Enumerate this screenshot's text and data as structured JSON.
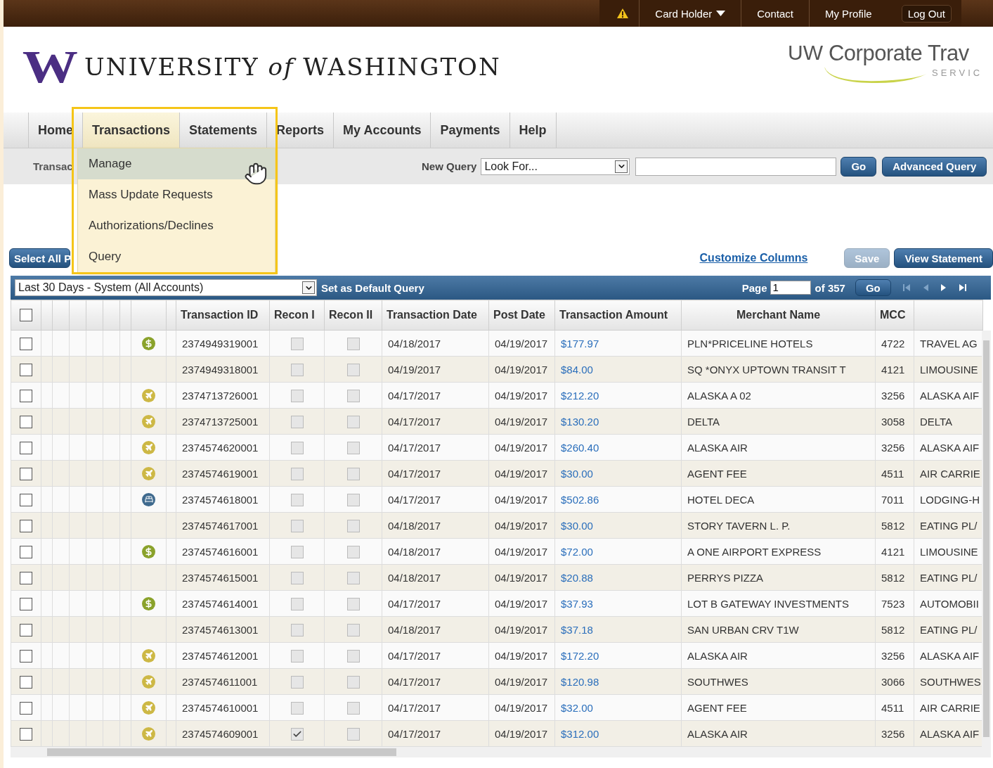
{
  "top_bar": {
    "items": [
      {
        "kind": "warning"
      },
      {
        "kind": "menu",
        "label": "Card Holder"
      },
      {
        "kind": "link",
        "label": "Contact"
      },
      {
        "kind": "link",
        "label": "My Profile"
      },
      {
        "kind": "button",
        "label": "Log Out"
      }
    ]
  },
  "header": {
    "logo_letter": "W",
    "university": "UNIVERSITY *of* WASHINGTON",
    "brand_prefix": "UW",
    "brand_name": "Corporate Trav",
    "brand_sub": "SERVIC"
  },
  "nav": {
    "tabs": [
      {
        "label": "Home",
        "selected": false
      },
      {
        "label": "Transactions",
        "selected": true
      },
      {
        "label": "Statements",
        "selected": false
      },
      {
        "label": "Reports",
        "selected": false
      },
      {
        "label": "My Accounts",
        "selected": false
      },
      {
        "label": "Payments",
        "selected": false
      },
      {
        "label": "Help",
        "selected": false
      }
    ],
    "menu": [
      {
        "label": "Manage",
        "selected": true
      },
      {
        "label": "Mass Update Requests",
        "selected": false
      },
      {
        "label": "Authorizations/Declines",
        "selected": false
      },
      {
        "label": "Query",
        "selected": false
      }
    ]
  },
  "sub_bar": {
    "title": "Transac",
    "new_query_label": "New Query",
    "select_value": "Look For...",
    "go": "Go",
    "advanced": "Advanced Query"
  },
  "toolbar": {
    "select_all": "Select All P",
    "customize": "Customize Columns",
    "save": "Save",
    "save_disabled": true,
    "view_statement": "View Statement"
  },
  "query_bar": {
    "query": "Last 30 Days - System (All Accounts)",
    "set_default": "Set as Default Query",
    "page_label": "Page",
    "page_value": "1",
    "of_pages": "of 357",
    "go": "Go"
  },
  "table": {
    "select_all_checked": false,
    "columns": [
      "Transaction ID",
      "Recon I",
      "Recon II",
      "Transaction Date",
      "Post Date",
      "Transaction Amount",
      "Merchant Name",
      "MCC"
    ],
    "rows": [
      {
        "checked": false,
        "kind": "dollar",
        "id": "2374949319001",
        "recon_1": false,
        "recon_2": false,
        "transaction_date": "04/18/2017",
        "post_date": "04/19/2017",
        "amount": "$177.97",
        "merchant": "PLN*PRICELINE HOTELS",
        "mcc": "4722",
        "column_12": "TRAVEL AG"
      },
      {
        "checked": false,
        "kind": "plain",
        "id": "2374949318001",
        "recon_1": false,
        "recon_2": false,
        "transaction_date": "04/19/2017",
        "post_date": "04/19/2017",
        "amount": "$84.00",
        "merchant": "SQ *ONYX UPTOWN TRANSIT T",
        "mcc": "4121",
        "column_12": "LIMOUSINE"
      },
      {
        "checked": false,
        "kind": "plane",
        "id": "2374713726001",
        "recon_1": false,
        "recon_2": false,
        "transaction_date": "04/17/2017",
        "post_date": "04/19/2017",
        "amount": "$212.20",
        "merchant": "ALASKA A 02",
        "mcc": "3256",
        "column_12": "ALASKA AIF"
      },
      {
        "checked": false,
        "kind": "plane",
        "id": "2374713725001",
        "recon_1": false,
        "recon_2": false,
        "transaction_date": "04/17/2017",
        "post_date": "04/19/2017",
        "amount": "$130.20",
        "merchant": "DELTA",
        "mcc": "3058",
        "column_12": "DELTA"
      },
      {
        "checked": false,
        "kind": "plane",
        "id": "2374574620001",
        "recon_1": false,
        "recon_2": false,
        "transaction_date": "04/17/2017",
        "post_date": "04/19/2017",
        "amount": "$260.40",
        "merchant": "ALASKA AIR",
        "mcc": "3256",
        "column_12": "ALASKA AIF"
      },
      {
        "checked": false,
        "kind": "plane",
        "id": "2374574619001",
        "recon_1": false,
        "recon_2": false,
        "transaction_date": "04/17/2017",
        "post_date": "04/19/2017",
        "amount": "$30.00",
        "merchant": "AGENT FEE",
        "mcc": "4511",
        "column_12": "AIR CARRIE"
      },
      {
        "checked": false,
        "kind": "hotel",
        "id": "2374574618001",
        "recon_1": false,
        "recon_2": false,
        "transaction_date": "04/17/2017",
        "post_date": "04/19/2017",
        "amount": "$502.86",
        "merchant": "HOTEL DECA",
        "mcc": "7011",
        "column_12": "LODGING-H"
      },
      {
        "checked": false,
        "kind": "plain",
        "id": "2374574617001",
        "recon_1": false,
        "recon_2": false,
        "transaction_date": "04/18/2017",
        "post_date": "04/19/2017",
        "amount": "$30.00",
        "merchant": "STORY TAVERN L. P.",
        "mcc": "5812",
        "column_12": "EATING PL/"
      },
      {
        "checked": false,
        "kind": "dollar",
        "id": "2374574616001",
        "recon_1": false,
        "recon_2": false,
        "transaction_date": "04/18/2017",
        "post_date": "04/19/2017",
        "amount": "$72.00",
        "merchant": "A ONE AIRPORT EXPRESS",
        "mcc": "4121",
        "column_12": "LIMOUSINE"
      },
      {
        "checked": false,
        "kind": "plain",
        "id": "2374574615001",
        "recon_1": false,
        "recon_2": false,
        "transaction_date": "04/18/2017",
        "post_date": "04/19/2017",
        "amount": "$20.88",
        "merchant": "PERRYS PIZZA",
        "mcc": "5812",
        "column_12": "EATING PL/"
      },
      {
        "checked": false,
        "kind": "dollar",
        "id": "2374574614001",
        "recon_1": false,
        "recon_2": false,
        "transaction_date": "04/17/2017",
        "post_date": "04/19/2017",
        "amount": "$37.93",
        "merchant": "LOT B GATEWAY INVESTMENTS",
        "mcc": "7523",
        "column_12": "AUTOMOBII"
      },
      {
        "checked": false,
        "kind": "plain",
        "id": "2374574613001",
        "recon_1": false,
        "recon_2": false,
        "transaction_date": "04/18/2017",
        "post_date": "04/19/2017",
        "amount": "$37.18",
        "merchant": "SAN URBAN CRV T1W",
        "mcc": "5812",
        "column_12": "EATING PL/"
      },
      {
        "checked": false,
        "kind": "plane",
        "id": "2374574612001",
        "recon_1": false,
        "recon_2": false,
        "transaction_date": "04/17/2017",
        "post_date": "04/19/2017",
        "amount": "$172.20",
        "merchant": "ALASKA AIR",
        "mcc": "3256",
        "column_12": "ALASKA AIF"
      },
      {
        "checked": false,
        "kind": "plane",
        "id": "2374574611001",
        "recon_1": false,
        "recon_2": false,
        "transaction_date": "04/17/2017",
        "post_date": "04/19/2017",
        "amount": "$120.98",
        "merchant": "SOUTHWES",
        "mcc": "3066",
        "column_12": "SOUTHWES"
      },
      {
        "checked": false,
        "kind": "plane",
        "id": "2374574610001",
        "recon_1": false,
        "recon_2": false,
        "transaction_date": "04/17/2017",
        "post_date": "04/19/2017",
        "amount": "$32.00",
        "merchant": "AGENT FEE",
        "mcc": "4511",
        "column_12": "AIR CARRIE"
      },
      {
        "checked": false,
        "kind": "plane",
        "id": "2374574609001",
        "recon_1": true,
        "recon_2": false,
        "transaction_date": "04/17/2017",
        "post_date": "04/19/2017",
        "amount": "$312.00",
        "merchant": "ALASKA AIR",
        "mcc": "3256",
        "column_12": "ALASKA AIF"
      }
    ]
  }
}
